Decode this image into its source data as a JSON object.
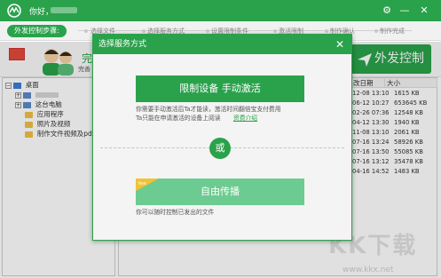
{
  "titlebar": {
    "greeting": "你好，",
    "settings_icon": "gear-icon",
    "min_label": "—",
    "close_label": "✕"
  },
  "stepbar": {
    "label": "外发控制步骤:",
    "steps": [
      "选择文件",
      "选择服务方式",
      "设置限制条件",
      "激活限制",
      "制作确认",
      "制作完成"
    ]
  },
  "product": {
    "done_text": "完",
    "done_sub": "完善",
    "ext_button": "外发控制"
  },
  "tree": {
    "desktop": "桌面",
    "computer": "这台电脑",
    "apps": "应用程序",
    "photos": "照片及视频",
    "make": "制作文件视频及pdf"
  },
  "filelist": {
    "headers": {
      "date": "改日期",
      "size": "大小"
    },
    "rows": [
      {
        "date": "12-08 13:10",
        "size": "1615 KB"
      },
      {
        "date": "06-12 10:27",
        "size": "653645 KB"
      },
      {
        "date": "02-26 07:36",
        "size": "12548 KB"
      },
      {
        "date": "04-12 13:30",
        "size": "1940 KB"
      },
      {
        "date": "11-08 13:10",
        "size": "2061 KB"
      },
      {
        "date": "07-16 13:24",
        "size": "58926 KB"
      },
      {
        "date": "07-16 13:50",
        "size": "55085 KB"
      },
      {
        "date": "07-16 13:12",
        "size": "35478 KB"
      },
      {
        "date": "04-16 14:52",
        "size": "1483 KB"
      }
    ]
  },
  "watermark": {
    "text": "KK下载",
    "url": "www.kkx.net"
  },
  "modal": {
    "title": "选择服务方式",
    "close": "✕",
    "option1": "限制设备 手动激活",
    "option1_desc_line1": "你需要手动激活后Ta才能读，激活时间翻倍宝支付费用",
    "option1_desc_line2": "Ta只能在申请激活的设备上阅读",
    "details_link": "资费介绍",
    "or": "或",
    "free_tag": "free",
    "option2": "自由传播",
    "option2_desc": "你可以随时控制已发出的文件"
  },
  "colors": {
    "accent": "#2aa24b",
    "accent_light": "#6ccb90"
  }
}
